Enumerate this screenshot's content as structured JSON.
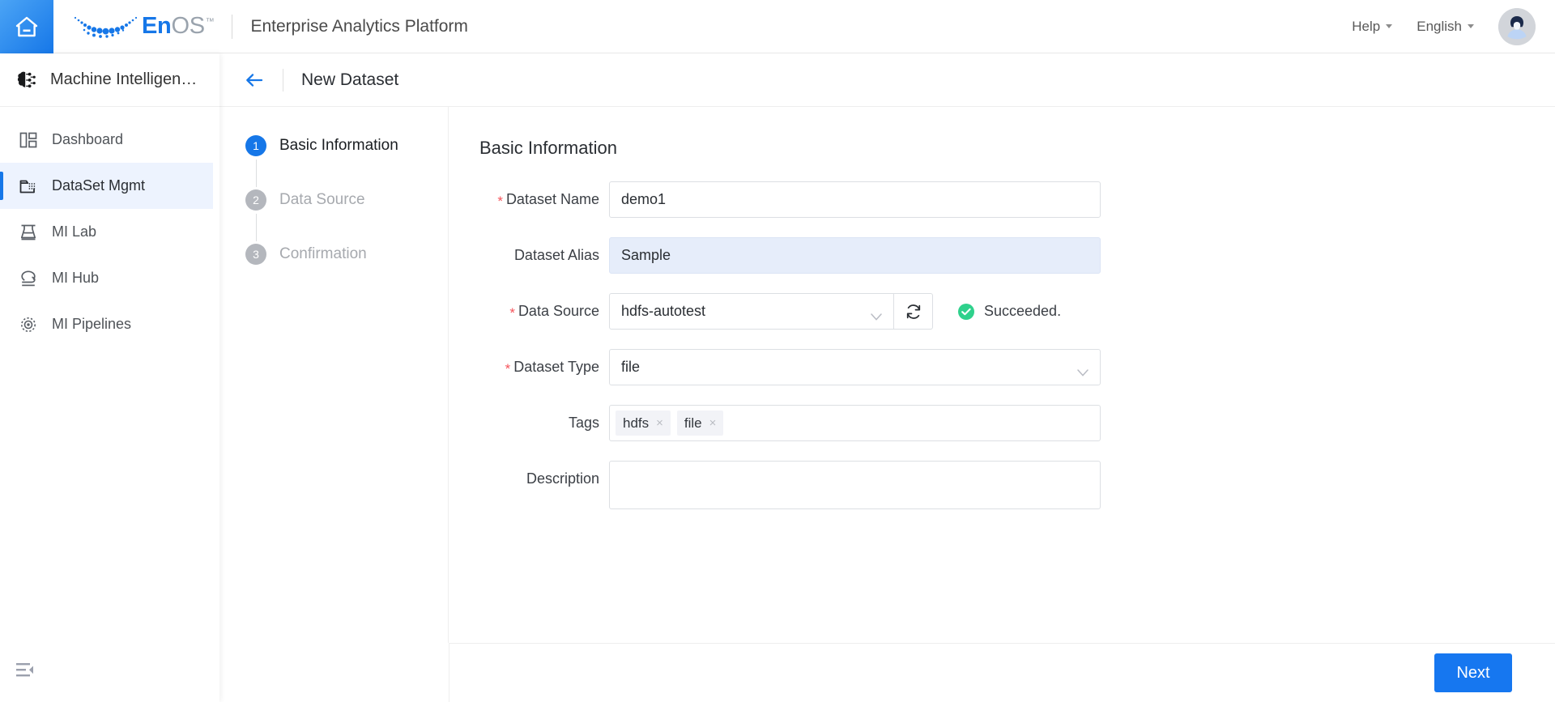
{
  "topbar": {
    "home_icon": "home-icon",
    "logo_text_primary": "En",
    "logo_text_secondary": "OS",
    "logo_tm": "™",
    "platform_title": "Enterprise Analytics Platform",
    "help_label": "Help",
    "language_label": "English",
    "avatar": "user-avatar"
  },
  "sidebar": {
    "header_label": "Machine Intelligen…",
    "header_icon": "brain-circuit-icon",
    "items": [
      {
        "label": "Dashboard",
        "icon": "dashboard-icon",
        "active": false
      },
      {
        "label": "DataSet Mgmt",
        "icon": "folder-data-icon",
        "active": true
      },
      {
        "label": "MI Lab",
        "icon": "flask-icon",
        "active": false
      },
      {
        "label": "MI Hub",
        "icon": "hub-icon",
        "active": false
      },
      {
        "label": "MI Pipelines",
        "icon": "pipeline-gear-icon",
        "active": false
      }
    ],
    "collapse_icon": "menu-fold-icon"
  },
  "page_header": {
    "back_icon": "arrow-left-icon",
    "title": "New Dataset"
  },
  "steps": [
    {
      "number": "1",
      "label": "Basic Information",
      "active": true
    },
    {
      "number": "2",
      "label": "Data Source",
      "active": false
    },
    {
      "number": "3",
      "label": "Confirmation",
      "active": false
    }
  ],
  "form": {
    "section_title": "Basic Information",
    "dataset_name": {
      "label": "Dataset Name",
      "required": true,
      "value": "demo1",
      "placeholder": ""
    },
    "dataset_alias": {
      "label": "Dataset Alias",
      "required": false,
      "value": "Sample",
      "placeholder": ""
    },
    "data_source": {
      "label": "Data Source",
      "required": true,
      "value": "hdfs-autotest",
      "refresh_icon": "refresh-icon",
      "status_icon": "success-check-icon",
      "status_text": "Succeeded."
    },
    "dataset_type": {
      "label": "Dataset Type",
      "required": true,
      "value": "file"
    },
    "tags": {
      "label": "Tags",
      "required": false,
      "values": [
        "hdfs",
        "file"
      ],
      "remove_glyph": "×"
    },
    "description": {
      "label": "Description",
      "required": false,
      "value": "",
      "placeholder": ""
    },
    "required_marker": "*"
  },
  "footer": {
    "next_label": "Next"
  },
  "colors": {
    "accent": "#1677e8",
    "next_button": "#1677f0",
    "required_star": "#f5545b",
    "success": "#2fd18c",
    "active_nav_bg": "#edf3fe",
    "alias_field_bg": "#e6edfa"
  }
}
